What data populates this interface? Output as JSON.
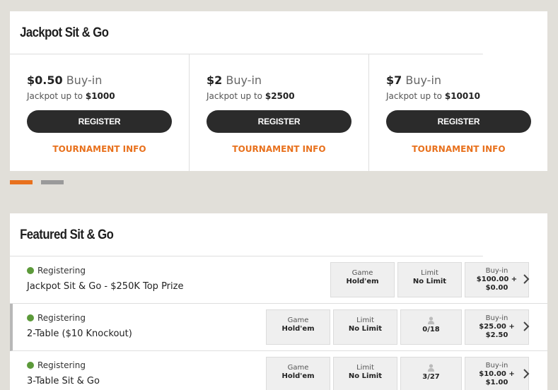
{
  "jackpot": {
    "title": "Jackpot Sit & Go",
    "cards": [
      {
        "price": "$0.50",
        "buyin_word": "Buy-in",
        "jackpot_prefix": "Jackpot up to",
        "jackpot_amount": "$1000",
        "register_label": "REGISTER",
        "info_label": "TOURNAMENT INFO"
      },
      {
        "price": "$2",
        "buyin_word": "Buy-in",
        "jackpot_prefix": "Jackpot up to",
        "jackpot_amount": "$2500",
        "register_label": "REGISTER",
        "info_label": "TOURNAMENT INFO"
      },
      {
        "price": "$7",
        "buyin_word": "Buy-in",
        "jackpot_prefix": "Jackpot up to",
        "jackpot_amount": "$10010",
        "register_label": "REGISTER",
        "info_label": "TOURNAMENT INFO"
      }
    ],
    "carousel": {
      "pages": 2,
      "active_index": 0
    }
  },
  "featured": {
    "title": "Featured Sit & Go",
    "rows": [
      {
        "status": "Registering",
        "name": "Jackpot Sit & Go - $250K Top Prize",
        "game_label": "Game",
        "game": "Hold'em",
        "limit_label": "Limit",
        "limit": "No Limit",
        "players": "",
        "buyin_label": "Buy-in",
        "buyin": "$100.00 +",
        "fee": "$0.00"
      },
      {
        "status": "Registering",
        "name": "2-Table ($10 Knockout)",
        "game_label": "Game",
        "game": "Hold'em",
        "limit_label": "Limit",
        "limit": "No Limit",
        "players": "0/18",
        "buyin_label": "Buy-in",
        "buyin": "$25.00 +",
        "fee": "$2.50"
      },
      {
        "status": "Registering",
        "name": "3-Table Sit & Go",
        "game_label": "Game",
        "game": "Hold'em",
        "limit_label": "Limit",
        "limit": "No Limit",
        "players": "3/27",
        "buyin_label": "Buy-in",
        "buyin": "$10.00 +",
        "fee": "$1.00"
      }
    ]
  },
  "colors": {
    "accent": "#e8711d",
    "status_green": "#5c9a3a",
    "button_dark": "#2b2b2b",
    "background": "#e1dfd9"
  },
  "icons": {
    "status": "status-dot-icon",
    "players": "user-icon",
    "row_open": "chevron-right-icon"
  }
}
